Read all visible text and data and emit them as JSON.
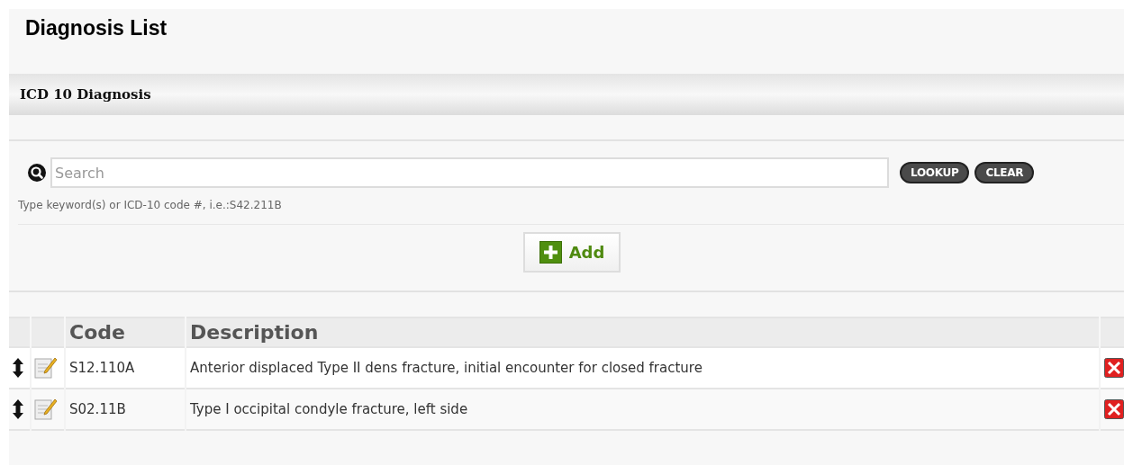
{
  "page_title": "Diagnosis List",
  "section_title": "ICD 10 Diagnosis",
  "search": {
    "placeholder": "Search",
    "hint": "Type keyword(s) or ICD-10 code #, i.e.:S42.211B"
  },
  "search_buttons": [
    "LOOKUP",
    "CLEAR"
  ],
  "add_button": "Add",
  "table": {
    "columns": [
      "Code",
      "Description"
    ],
    "rows": [
      {
        "code": "S12.110A",
        "description": "Anterior displaced Type II dens fracture, initial encounter for closed fracture"
      },
      {
        "code": "S02.11B",
        "description": "Type I occipital condyle fracture, left side"
      }
    ]
  }
}
